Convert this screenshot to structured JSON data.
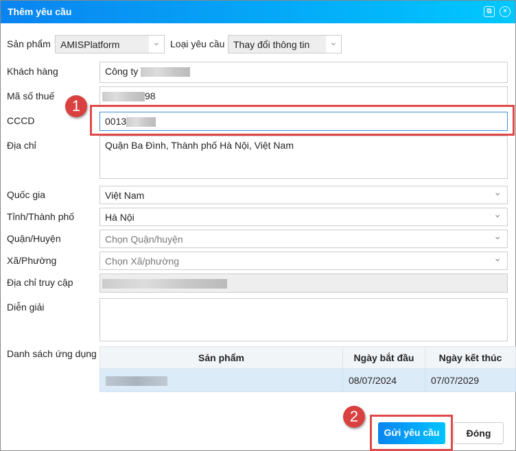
{
  "dialog": {
    "title": "Thêm yêu cầu",
    "icons": [
      "restore-icon",
      "close-icon"
    ]
  },
  "form": {
    "product_label": "Sản phẩm",
    "product_value": "AMISPlatform",
    "request_type_label": "Loại yêu cầu",
    "request_type_value": "Thay đổi thông tin",
    "customer_label": "Khách hàng",
    "customer_value": "Công ty",
    "tax_label": "Mã số thuế",
    "tax_value_suffix": "98",
    "cccd_label": "CCCD",
    "cccd_value": "0013",
    "address_label": "Địa chỉ",
    "address_value": "Quận Ba Đình, Thành phố Hà Nội, Việt Nam",
    "country_label": "Quốc gia",
    "country_value": "Việt Nam",
    "city_label": "Tỉnh/Thành phố",
    "city_value": "Hà Nội",
    "district_label": "Quận/Huyện",
    "district_placeholder": "Chọn Quận/huyện",
    "ward_label": "Xã/Phường",
    "ward_placeholder": "Chọn Xã/phường",
    "access_label": "Địa chỉ truy cập",
    "note_label": "Diễn giải"
  },
  "apps": {
    "label": "Danh sách ứng dụng",
    "columns": [
      "Sản phẩm",
      "Ngày bắt đầu",
      "Ngày kết thúc"
    ],
    "rows": [
      {
        "start": "08/07/2024",
        "end": "07/07/2029"
      }
    ]
  },
  "buttons": {
    "submit": "Gửi yêu cầu",
    "close": "Đóng"
  },
  "annotations": [
    "1",
    "2"
  ]
}
